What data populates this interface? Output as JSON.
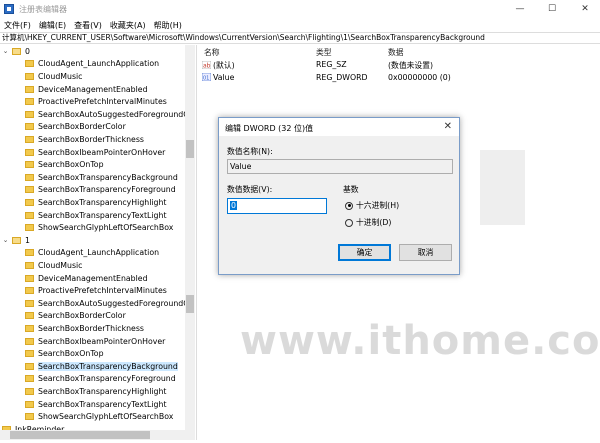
{
  "window": {
    "title": "注册表编辑器",
    "controls": [
      "—",
      "☐",
      "✕"
    ]
  },
  "menu": [
    "文件(F)",
    "编辑(E)",
    "查看(V)",
    "收藏夹(A)",
    "帮助(H)"
  ],
  "address": "计算机\\HKEY_CURRENT_USER\\Software\\Microsoft\\Windows\\CurrentVersion\\Search\\Flighting\\1\\SearchBoxTransparencyBackground",
  "tree": {
    "group0": {
      "label": "0",
      "items": [
        "CloudAgent_LaunchApplication",
        "CloudMusic",
        "DeviceManagementEnabled",
        "ProactivePrefetchIntervalMinutes",
        "SearchBoxAutoSuggestedForegroundCo",
        "SearchBoxBorderColor",
        "SearchBoxBorderThickness",
        "SearchBoxIbeamPointerOnHover",
        "SearchBoxOnTop",
        "SearchBoxTransparencyBackground",
        "SearchBoxTransparencyForeground",
        "SearchBoxTransparencyHighlight",
        "SearchBoxTransparencyTextLight",
        "ShowSearchGlyphLeftOfSearchBox"
      ]
    },
    "group1": {
      "label": "1",
      "items": [
        "CloudAgent_LaunchApplication",
        "CloudMusic",
        "DeviceManagementEnabled",
        "ProactivePrefetchIntervalMinutes",
        "SearchBoxAutoSuggestedForegroundCo",
        "SearchBoxBorderColor",
        "SearchBoxBorderThickness",
        "SearchBoxIbeamPointerOnHover",
        "SearchBoxOnTop",
        "SearchBoxTransparencyBackground",
        "SearchBoxTransparencyForeground",
        "SearchBoxTransparencyHighlight",
        "SearchBoxTransparencyTextLight",
        "ShowSearchGlyphLeftOfSearchBox"
      ],
      "selected_index": 9
    },
    "tail": "InkReminder"
  },
  "list": {
    "headers": {
      "name": "名称",
      "type": "类型",
      "data": "数据"
    },
    "rows": [
      {
        "name": "(默认)",
        "type": "REG_SZ",
        "data": "(数值未设置)",
        "icon": "ab-string-icon"
      },
      {
        "name": "Value",
        "type": "REG_DWORD",
        "data": "0x00000000 (0)",
        "icon": "binary-value-icon"
      }
    ]
  },
  "dialog": {
    "title": "编辑 DWORD (32 位)值",
    "close": "✕",
    "name_label": "数值名称(N):",
    "name_value": "Value",
    "data_label": "数值数据(V):",
    "data_value": "0",
    "base_label": "基数",
    "radio_hex": "十六进制(H)",
    "radio_dec": "十进制(D)",
    "selected_base": "hex",
    "ok": "确定",
    "cancel": "取消"
  },
  "watermark": "www.ithome.com",
  "colors": {
    "selection": "#cce8ff",
    "accent": "#0078d7",
    "folder": "#f2c94c"
  }
}
